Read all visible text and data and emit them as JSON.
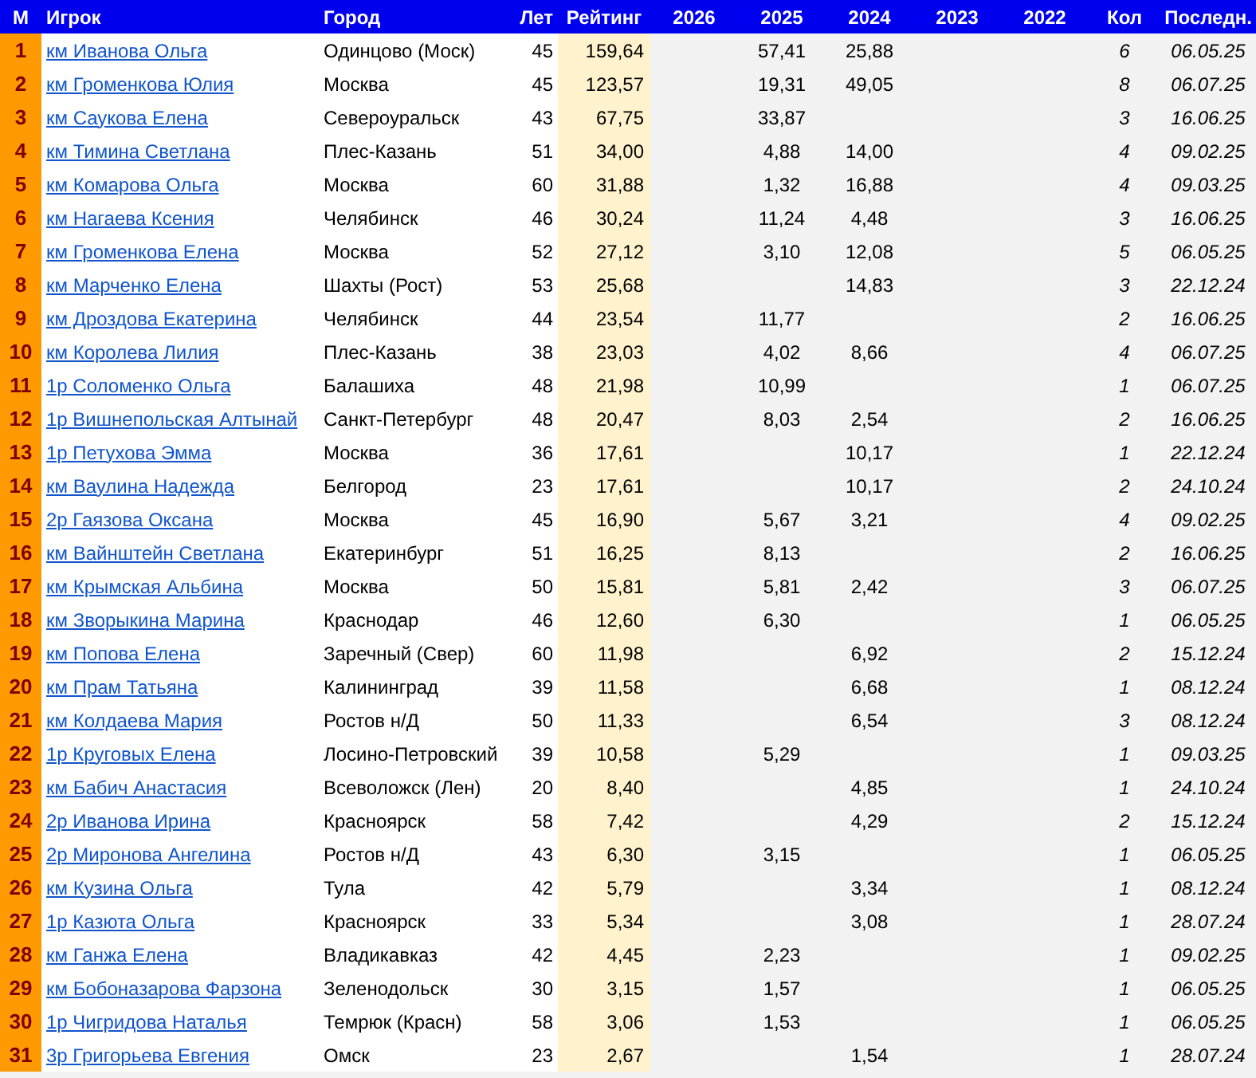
{
  "table": {
    "columns": [
      "М",
      "Игрок",
      "Город",
      "Лет",
      "Рейтинг",
      "2026",
      "2025",
      "2024",
      "2023",
      "2022",
      "Кол",
      "Последн."
    ],
    "rows": [
      {
        "rank": "1",
        "player": "км Иванова Ольга",
        "city": "Одинцово (Моск)",
        "age": "45",
        "rating": "159,64",
        "y2025": "57,41",
        "y2024": "25,88",
        "count": "6",
        "last": "06.05.25"
      },
      {
        "rank": "2",
        "player": "км Громенкова Юлия",
        "city": "Москва",
        "age": "45",
        "rating": "123,57",
        "y2025": "19,31",
        "y2024": "49,05",
        "count": "8",
        "last": "06.07.25"
      },
      {
        "rank": "3",
        "player": "км Саукова Елена",
        "city": "Североуральск",
        "age": "43",
        "rating": "67,75",
        "y2025": "33,87",
        "count": "3",
        "last": "16.06.25"
      },
      {
        "rank": "4",
        "player": "км Тимина Светлана",
        "city": "Плес-Казань",
        "age": "51",
        "rating": "34,00",
        "y2025": "4,88",
        "y2024": "14,00",
        "count": "4",
        "last": "09.02.25"
      },
      {
        "rank": "5",
        "player": "км Комарова Ольга",
        "city": "Москва",
        "age": "60",
        "rating": "31,88",
        "y2025": "1,32",
        "y2024": "16,88",
        "count": "4",
        "last": "09.03.25"
      },
      {
        "rank": "6",
        "player": "км Нагаева Ксения",
        "city": "Челябинск",
        "age": "46",
        "rating": "30,24",
        "y2025": "11,24",
        "y2024": "4,48",
        "count": "3",
        "last": "16.06.25"
      },
      {
        "rank": "7",
        "player": "км Громенкова Елена",
        "city": "Москва",
        "age": "52",
        "rating": "27,12",
        "y2025": "3,10",
        "y2024": "12,08",
        "count": "5",
        "last": "06.05.25"
      },
      {
        "rank": "8",
        "player": "км Марченко Елена",
        "city": "Шахты (Рост)",
        "age": "53",
        "rating": "25,68",
        "y2024": "14,83",
        "count": "3",
        "last": "22.12.24"
      },
      {
        "rank": "9",
        "player": "км Дроздова Екатерина",
        "city": "Челябинск",
        "age": "44",
        "rating": "23,54",
        "y2025": "11,77",
        "count": "2",
        "last": "16.06.25"
      },
      {
        "rank": "10",
        "player": "км Королева Лилия",
        "city": "Плес-Казань",
        "age": "38",
        "rating": "23,03",
        "y2025": "4,02",
        "y2024": "8,66",
        "count": "4",
        "last": "06.07.25"
      },
      {
        "rank": "11",
        "player": "1р Соломенко Ольга",
        "city": "Балашиха",
        "age": "48",
        "rating": "21,98",
        "y2025": "10,99",
        "count": "1",
        "last": "06.07.25"
      },
      {
        "rank": "12",
        "player": "1р Вишнепольская Алтынай",
        "city": "Санкт-Петербург",
        "age": "48",
        "rating": "20,47",
        "y2025": "8,03",
        "y2024": "2,54",
        "count": "2",
        "last": "16.06.25"
      },
      {
        "rank": "13",
        "player": "1р Петухова Эмма",
        "city": "Москва",
        "age": "36",
        "rating": "17,61",
        "y2024": "10,17",
        "count": "1",
        "last": "22.12.24"
      },
      {
        "rank": "14",
        "player": "км Ваулина Надежда",
        "city": "Белгород",
        "age": "23",
        "rating": "17,61",
        "y2024": "10,17",
        "count": "2",
        "last": "24.10.24"
      },
      {
        "rank": "15",
        "player": "2р Гаязова Оксана",
        "city": "Москва",
        "age": "45",
        "rating": "16,90",
        "y2025": "5,67",
        "y2024": "3,21",
        "count": "4",
        "last": "09.02.25"
      },
      {
        "rank": "16",
        "player": "км Вайнштейн Светлана",
        "city": "Екатеринбург",
        "age": "51",
        "rating": "16,25",
        "y2025": "8,13",
        "count": "2",
        "last": "16.06.25"
      },
      {
        "rank": "17",
        "player": "км Крымская Альбина",
        "city": "Москва",
        "age": "50",
        "rating": "15,81",
        "y2025": "5,81",
        "y2024": "2,42",
        "count": "3",
        "last": "06.07.25"
      },
      {
        "rank": "18",
        "player": "км Зворыкина Марина",
        "city": "Краснодар",
        "age": "46",
        "rating": "12,60",
        "y2025": "6,30",
        "count": "1",
        "last": "06.05.25"
      },
      {
        "rank": "19",
        "player": "км Попова Елена",
        "city": "Заречный (Свер)",
        "age": "60",
        "rating": "11,98",
        "y2024": "6,92",
        "count": "2",
        "last": "15.12.24"
      },
      {
        "rank": "20",
        "player": "км Прам Татьяна",
        "city": "Калининград",
        "age": "39",
        "rating": "11,58",
        "y2024": "6,68",
        "count": "1",
        "last": "08.12.24"
      },
      {
        "rank": "21",
        "player": "км Колдаева Мария",
        "city": "Ростов н/Д",
        "age": "50",
        "rating": "11,33",
        "y2024": "6,54",
        "count": "3",
        "last": "08.12.24"
      },
      {
        "rank": "22",
        "player": "1р Круговых Елена",
        "city": "Лосино-Петровский",
        "age": "39",
        "rating": "10,58",
        "y2025": "5,29",
        "count": "1",
        "last": "09.03.25"
      },
      {
        "rank": "23",
        "player": "км Бабич Анастасия",
        "city": "Всеволожск (Лен)",
        "age": "20",
        "rating": "8,40",
        "y2024": "4,85",
        "count": "1",
        "last": "24.10.24"
      },
      {
        "rank": "24",
        "player": "2р Иванова Ирина",
        "city": "Красноярск",
        "age": "58",
        "rating": "7,42",
        "y2024": "4,29",
        "count": "2",
        "last": "15.12.24"
      },
      {
        "rank": "25",
        "player": "2р Миронова Ангелина",
        "city": "Ростов н/Д",
        "age": "43",
        "rating": "6,30",
        "y2025": "3,15",
        "count": "1",
        "last": "06.05.25"
      },
      {
        "rank": "26",
        "player": "км Кузина Ольга",
        "city": "Тула",
        "age": "42",
        "rating": "5,79",
        "y2024": "3,34",
        "count": "1",
        "last": "08.12.24"
      },
      {
        "rank": "27",
        "player": "1р Казюта Ольга",
        "city": "Красноярск",
        "age": "33",
        "rating": "5,34",
        "y2024": "3,08",
        "count": "1",
        "last": "28.07.24"
      },
      {
        "rank": "28",
        "player": "км Ганжа Елена",
        "city": "Владикавказ",
        "age": "42",
        "rating": "4,45",
        "y2025": "2,23",
        "count": "1",
        "last": "09.02.25"
      },
      {
        "rank": "29",
        "player": "км Бобоназарова Фарзона",
        "city": "Зеленодольск",
        "age": "30",
        "rating": "3,15",
        "y2025": "1,57",
        "count": "1",
        "last": "06.05.25"
      },
      {
        "rank": "30",
        "player": "1р Чигридова Наталья",
        "city": "Темрюк (Красн)",
        "age": "58",
        "rating": "3,06",
        "y2025": "1,53",
        "count": "1",
        "last": "06.05.25"
      },
      {
        "rank": "31",
        "player": "3р Григорьева Евгения",
        "city": "Омск",
        "age": "23",
        "rating": "2,67",
        "y2024": "1,54",
        "count": "1",
        "last": "28.07.24"
      }
    ]
  }
}
